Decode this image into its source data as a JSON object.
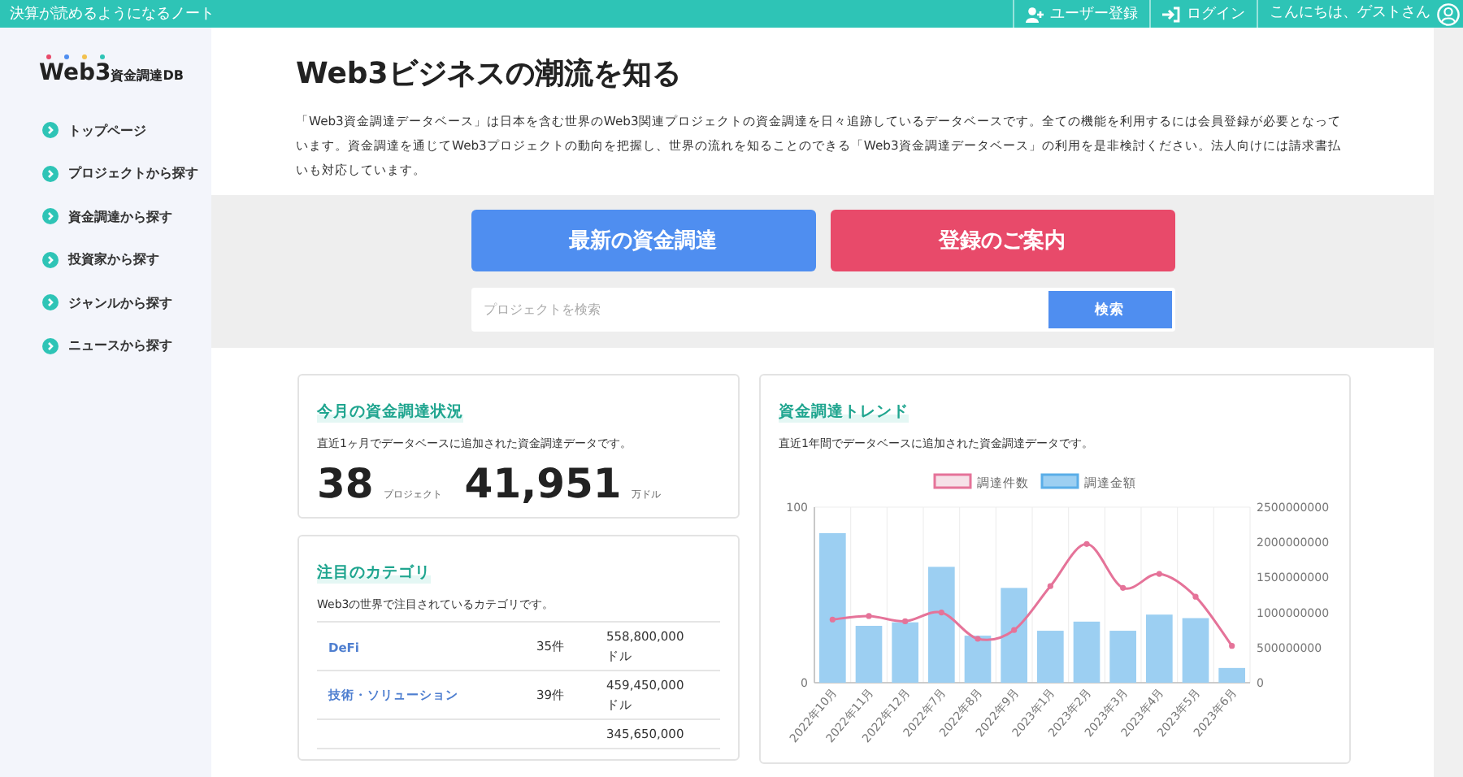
{
  "top_bar": {
    "site_name": "決算が読めるようになるノート",
    "links": [
      {
        "label": "ユーザー登録",
        "kind": "register"
      },
      {
        "label": "ログイン",
        "kind": "login"
      }
    ],
    "greeting": "こんにちは、ゲストさん"
  },
  "sidebar": {
    "logo": {
      "main": "Web3",
      "sub": "資金調達DB"
    },
    "items": [
      {
        "label": "トップページ"
      },
      {
        "label": "プロジェクトから探す"
      },
      {
        "label": "資金調達から探す"
      },
      {
        "label": "投資家から探す"
      },
      {
        "label": "ジャンルから探す"
      },
      {
        "label": "ニュースから探す"
      }
    ]
  },
  "hero": {
    "title": "Web3ビジネスの潮流を知る",
    "description": "「Web3資金調達データベース」は日本を含む世界のWeb3関連プロジェクトの資金調達を日々追跡しているデータベースです。全ての機能を利用するには会員登録が必要となっています。資金調達を通じてWeb3プロジェクトの動向を把握し、世界の流れを知ることのできる「Web3資金調達データベース」の利用を是非検討ください。法人向けには請求書払いも対応しています。"
  },
  "actions": [
    {
      "label": "最新の資金調達",
      "kind": "primary"
    },
    {
      "label": "登録のご案内",
      "kind": "danger"
    }
  ],
  "search": {
    "placeholder": "プロジェクトを検索",
    "button": "検索"
  },
  "monthly": {
    "title": "今月の資金調達状況",
    "description": "直近1ヶ月でデータベースに追加された資金調達データです。",
    "stats": [
      {
        "value": "38",
        "unit": "プロジェクト"
      },
      {
        "value": "41,951",
        "unit": "万ドル"
      }
    ]
  },
  "categories": {
    "title": "注目のカテゴリ",
    "description": "Web3の世界で注目されているカテゴリです。",
    "rows": [
      {
        "name": "DeFi",
        "count": "35件",
        "amount": "558,800,000",
        "unit": "ドル"
      },
      {
        "name": "技術・ソリューション",
        "count": "39件",
        "amount": "459,450,000",
        "unit": "ドル"
      },
      {
        "amount": "345,650,000"
      }
    ]
  },
  "trend": {
    "title": "資金調達トレンド",
    "description": "直近1年間でデータベースに追加された資金調達データです。",
    "chart_data": {
      "type": "bar",
      "categories": [
        "2022年10月",
        "2022年11月",
        "2022年12月",
        "2022年7月",
        "2022年8月",
        "2022年9月",
        "2023年1月",
        "2023年2月",
        "2023年3月",
        "2023年4月",
        "2023年5月",
        "2023年6月"
      ],
      "series": [
        {
          "name": "調達件数",
          "color": "#e57399",
          "type": "line",
          "marker": "circle",
          "values": [
            36,
            38,
            35,
            40,
            25,
            30,
            55,
            79,
            54,
            62,
            49,
            21
          ]
        },
        {
          "name": "調達金額",
          "color": "#9ccff2",
          "type": "bar",
          "axis": "y2",
          "values": [
            2130000000,
            810000000,
            860000000,
            1650000000,
            670000000,
            1350000000,
            740000000,
            870000000,
            740000000,
            970000000,
            920000000,
            210000000
          ]
        }
      ],
      "legend": "top",
      "ylim": [
        0,
        100
      ],
      "yticks": [
        0,
        100
      ],
      "y2lim": [
        0,
        2500000000
      ],
      "y2ticks": [
        0,
        500000000,
        1000000000,
        1500000000,
        2000000000,
        2500000000
      ]
    }
  }
}
